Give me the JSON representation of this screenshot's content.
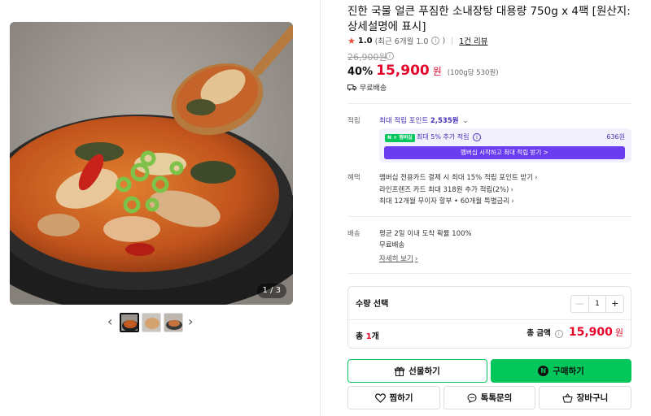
{
  "product": {
    "title": "진한 국물 얼큰 푸짐한 소내장탕 대용량 750g x 4팩 [원산지: 상세설명에 표시]",
    "rating": "1.0",
    "rating_note": "(최근 6개월 1.0",
    "rating_close": ")",
    "review_count": "1건 리뷰",
    "original_price": "26,900원",
    "discount": "40%",
    "price": "15,900",
    "currency": "원",
    "unit_price": "(100g당 530원)",
    "shipping_badge": "무료배송"
  },
  "gallery": {
    "counter": "1 / 3",
    "prev_icon": "chevron-left",
    "next_icon": "chevron-right",
    "thumbnails": 3,
    "selected": 1
  },
  "points": {
    "label": "적립",
    "max_text": "최대 적립 포인트 ",
    "max_value": "2,535원",
    "membership_badge": "N + 멤버십",
    "membership_text": "최대 5% 추가 적립",
    "membership_points": "636원",
    "membership_button": "멤버십 시작하고 최대 적립 받기 >"
  },
  "benefits": {
    "label": "혜택",
    "items": [
      "멤버십 전용카드 결제 시 최대 15% 적립 포인트 받기",
      "라인프렌즈 카드 최대 318원 추가 적립(2%)",
      "최대 12개월 무이자 할부 • 60개월 특별금리"
    ]
  },
  "delivery": {
    "label": "배송",
    "lines": [
      "평균 2일 이내 도착 확률 100%",
      "무료배송"
    ],
    "detail_link": "자세히 보기"
  },
  "quantity": {
    "label": "수량 선택",
    "value": "1",
    "minus": "—",
    "plus": "+",
    "total_count_prefix": "총 ",
    "total_count": "1",
    "total_count_suffix": "개",
    "total_label": "총 금액",
    "total_price": "15,900",
    "total_currency": "원"
  },
  "actions": {
    "gift": "선물하기",
    "buy": "구매하기",
    "buy_logo": "N",
    "wish": "찜하기",
    "talk": "톡톡문의",
    "cart": "장바구니"
  },
  "colors": {
    "price_red": "#e4062b",
    "naver_green": "#03c75a",
    "membership_purple": "#6a3df0"
  }
}
